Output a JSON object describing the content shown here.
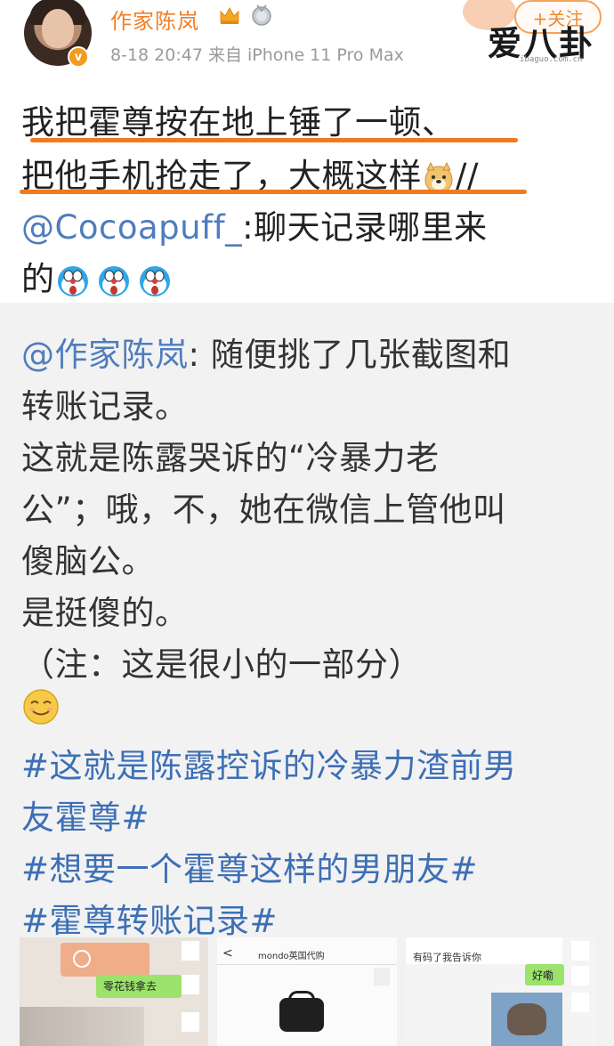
{
  "header": {
    "username": "作家陈岚",
    "meta": "8-18 20:47  来自 iPhone 11 Pro Max",
    "follow_label": "+关注",
    "verified_mark": "v",
    "watermark": "爱八卦",
    "watermark_sub": "ibaguo.com.cn"
  },
  "post": {
    "lines": [
      "我把霍尊按在地上锤了一顿、",
      "把他手机抢走了，大概这样",
      "//",
      "@Cocoapuff_",
      ":聊天记录哪里来",
      "的"
    ]
  },
  "quoted": {
    "mention": "@作家陈岚",
    "lines": [
      ": 随便挑了几张截图和",
      "转账记录。",
      "这就是陈露哭诉的“冷暴力老",
      "公”；哦，不，她在微信上管他叫",
      "傻脑公。",
      "是挺傻的。",
      "（注：这是很小的一部分）"
    ],
    "hashtags": [
      "#这就是陈露控诉的冷暴力渣前男",
      "友霍尊#",
      "#想要一个霍尊这样的男朋友#",
      "#霍尊转账记录#"
    ]
  },
  "thumbnails": {
    "t1_text": "零花钱拿去",
    "t2_title": "mondo英国代购",
    "t3_text_top": "有码了我告诉你",
    "t3_bubble": "好嘞"
  },
  "colors": {
    "accent_orange": "#f07e25",
    "mention_blue": "#4f7dbd",
    "hashtag_blue": "#3d6fb5",
    "underline_orange": "#f07a1f"
  },
  "icons": [
    "crown-icon",
    "medal-icon",
    "verified-icon",
    "doge-emoji",
    "doraemon-emoji",
    "smile-emoji",
    "back-arrow-icon"
  ]
}
